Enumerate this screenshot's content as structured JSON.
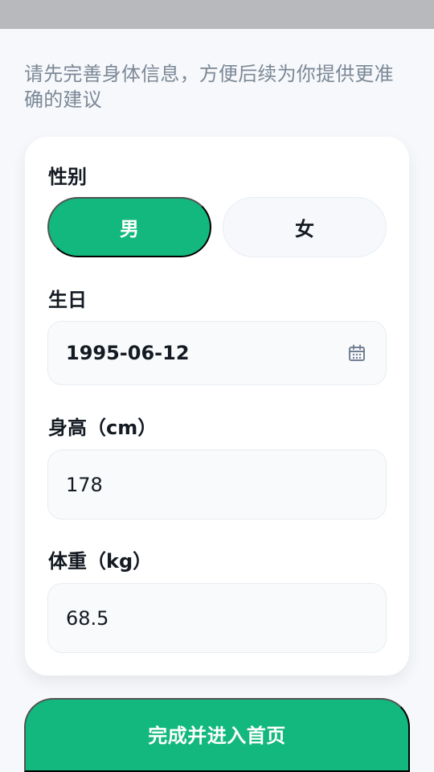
{
  "intro": {
    "text": "请先完善身体信息，方便后续为你提供更准确的建议"
  },
  "profile_form": {
    "gender": {
      "label": "性别",
      "options": [
        {
          "label": "男",
          "selected": true
        },
        {
          "label": "女",
          "selected": false
        }
      ]
    },
    "birthday": {
      "label": "生日",
      "value": "1995-06-12",
      "icon": "calendar-icon"
    },
    "height": {
      "label": "身高（cm）",
      "value": "178"
    },
    "weight": {
      "label": "体重（kg）",
      "value": "68.5"
    }
  },
  "actions": {
    "submit_label": "完成并进入首页"
  },
  "colors": {
    "accent": "#12b87e",
    "page_background": "#f6f8fb",
    "muted_text": "#7c8897"
  }
}
